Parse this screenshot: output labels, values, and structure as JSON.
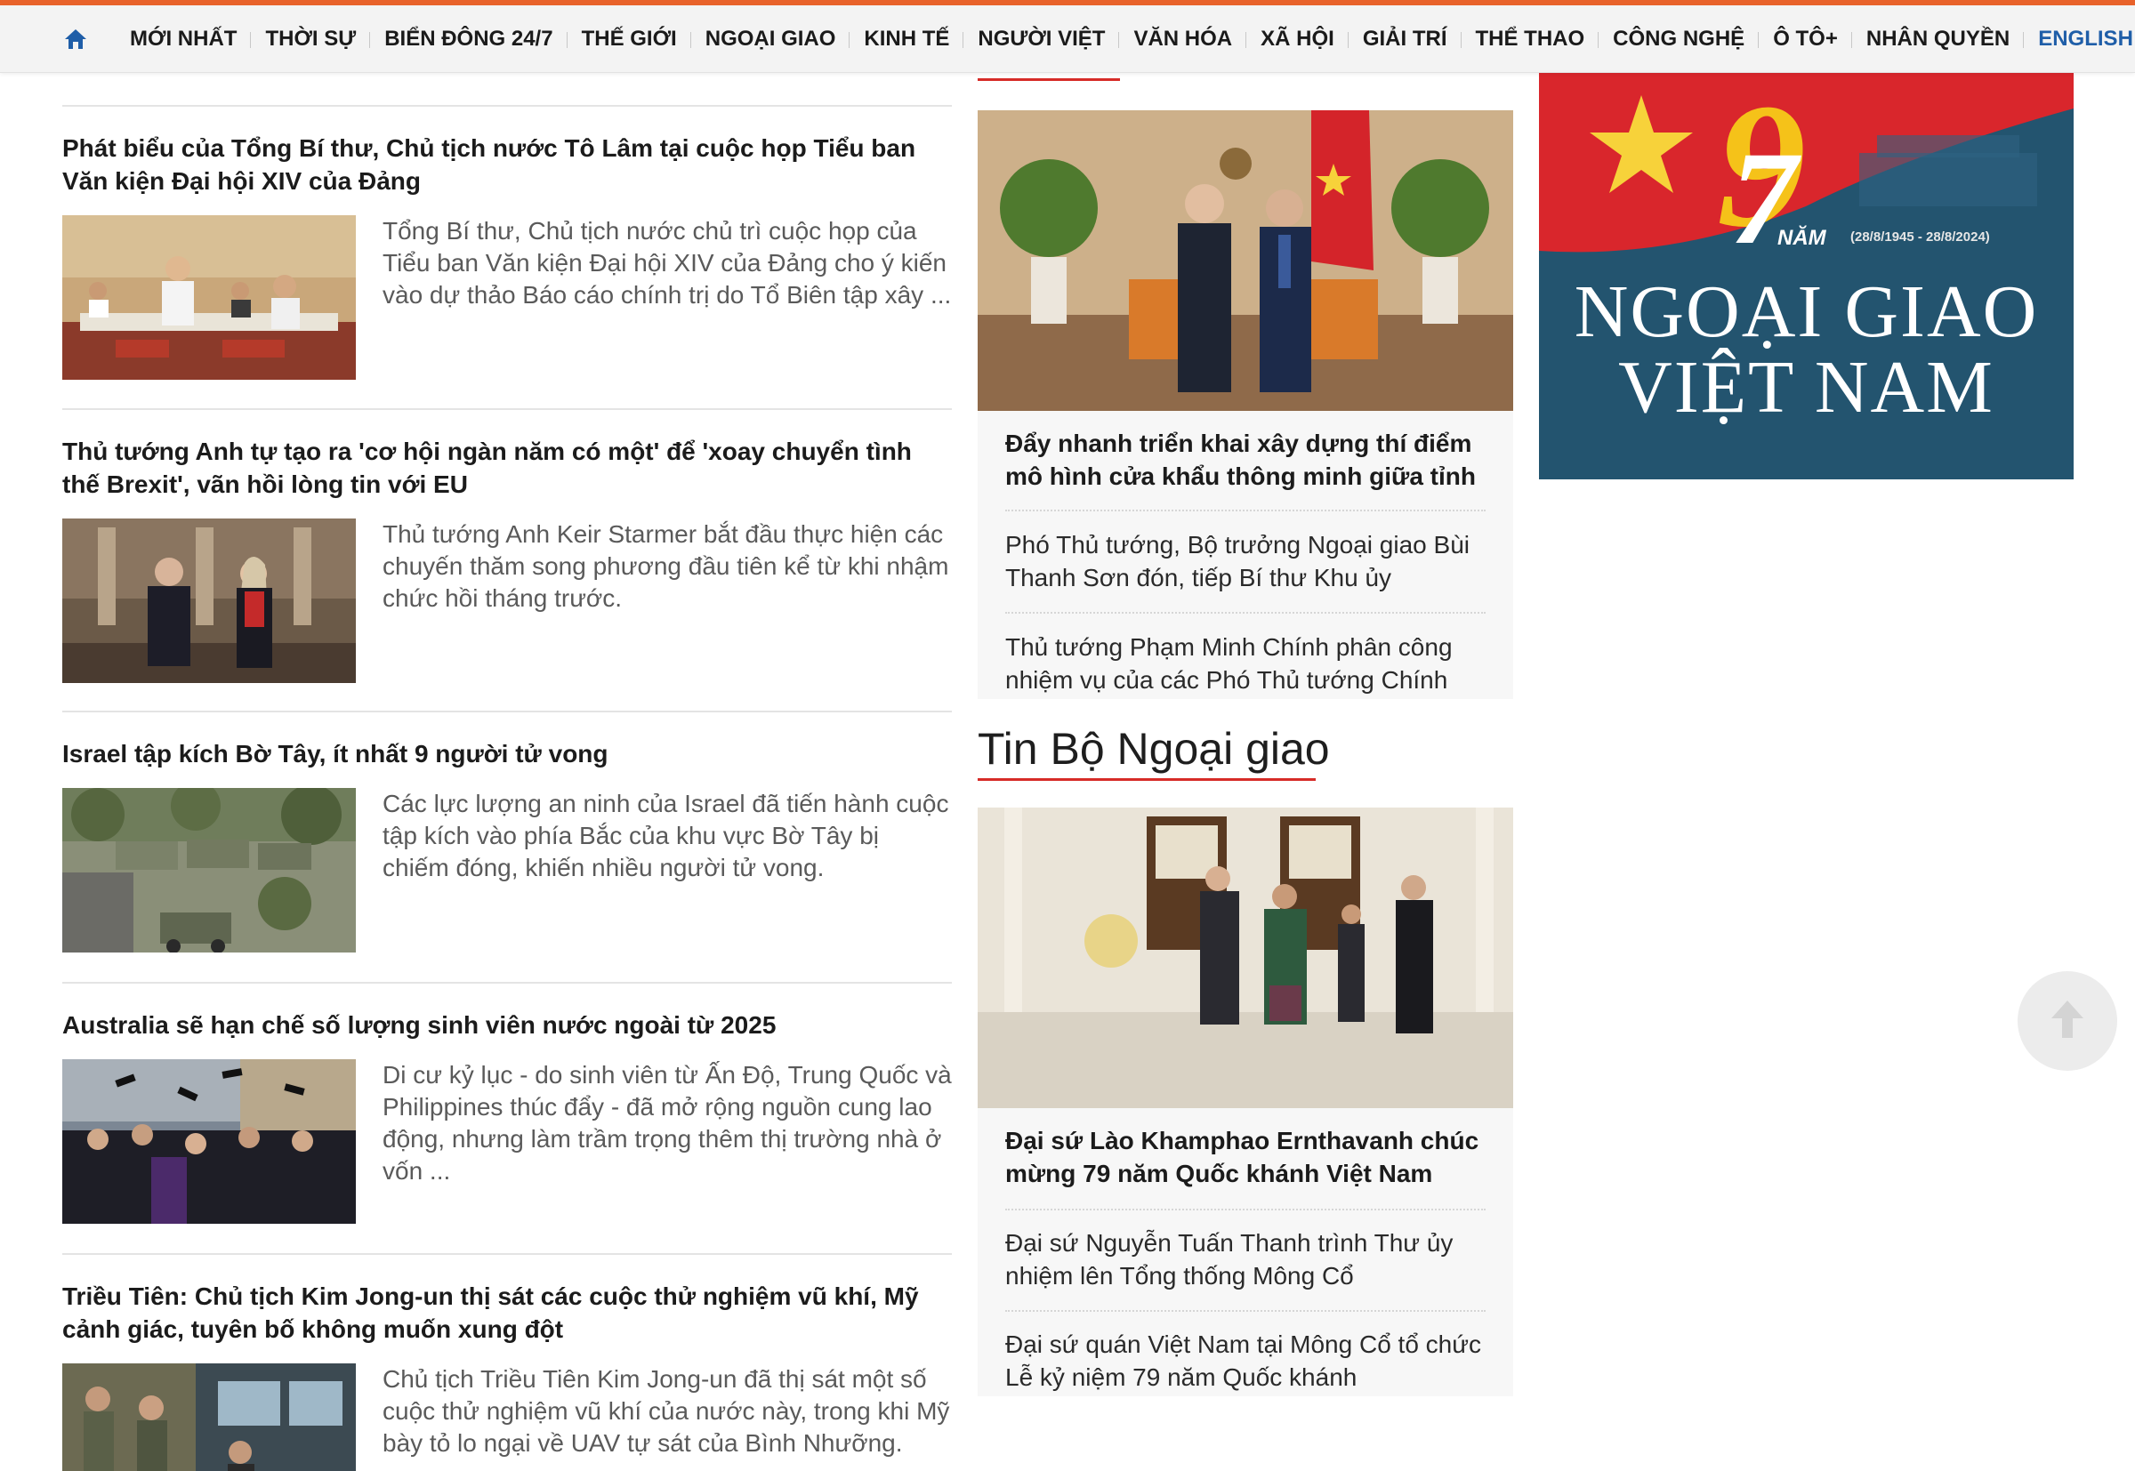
{
  "nav": {
    "home_icon": "home-icon",
    "items": [
      "MỚI NHẤT",
      "THỜI SỰ",
      "BIỂN ĐÔNG 24/7",
      "THẾ GIỚI",
      "NGOẠI GIAO",
      "KINH TẾ",
      "NGƯỜI VIỆT",
      "VĂN HÓA",
      "XÃ HỘI",
      "GIẢI TRÍ",
      "THỂ THAO",
      "CÔNG NGHỆ",
      "Ô TÔ+",
      "NHÂN QUYỀN"
    ],
    "english_label": "ENGLISH",
    "accent_color": "#e8622a",
    "english_color": "#1f5ea8"
  },
  "articles": [
    {
      "title": "Phát biểu của Tổng Bí thư, Chủ tịch nước Tô Lâm tại cuộc họp Tiểu ban Văn kiện Đại hội XIV của Đảng",
      "summary": "Tổng Bí thư, Chủ tịch nước chủ trì cuộc họp của Tiểu ban Văn kiện Đại hội XIV của Đảng cho ý kiến vào dự thảo Báo cáo chính trị do Tổ Biên tập xây ..."
    },
    {
      "title": "Thủ tướng Anh tự tạo ra 'cơ hội ngàn năm có một' để 'xoay chuyển tình thế Brexit', vãn hồi lòng tin với EU",
      "summary": "Thủ tướng Anh Keir Starmer bắt đầu thực hiện các chuyến thăm song phương đầu tiên kể từ khi nhậm chức hồi tháng trước."
    },
    {
      "title": "Israel tập kích Bờ Tây, ít nhất 9 người tử vong",
      "summary": "Các lực lượng an ninh của Israel đã tiến hành cuộc tập kích vào phía Bắc của khu vực Bờ Tây bị chiếm đóng, khiến nhiều người tử vong."
    },
    {
      "title": "Australia sẽ hạn chế số lượng sinh viên nước ngoài từ 2025",
      "summary": "Di cư kỷ lục - do sinh viên từ Ấn Độ, Trung Quốc và Philippines thúc đẩy - đã mở rộng nguồn cung lao động, nhưng làm trầm trọng thêm thị trường nhà ở vốn ..."
    },
    {
      "title": "Triều Tiên: Chủ tịch Kim Jong-un thị sát các cuộc thử nghiệm vũ khí, Mỹ cảnh giác, tuyên bố không muốn xung đột",
      "summary": "Chủ tịch Triều Tiên Kim Jong-un đã thị sát một số cuộc thử nghiệm vũ khí của nước này, trong khi Mỹ bày tỏ lo ngại về UAV tự sát của Bình Nhưỡng."
    }
  ],
  "middle": {
    "top_block": {
      "lead": "Đẩy nhanh triển khai xây dựng thí điểm mô hình cửa khẩu thông minh giữa tỉnh Lạng...",
      "items": [
        "Phó Thủ tướng, Bộ trưởng Ngoại giao Bùi Thanh Sơn đón, tiếp Bí thư Khu ủy Quảng...",
        "Thủ tướng Phạm Minh Chính phân công nhiệm vụ của các Phó Thủ tướng Chính p..."
      ]
    },
    "section_title": "Tin Bộ Ngoại giao",
    "section_block": {
      "lead": "Đại sứ Lào Khamphao Ernthavanh chúc mừng 79 năm Quốc khánh Việt Nam",
      "items": [
        "Đại sứ Nguyễn Tuấn Thanh trình Thư ủy nhiệm lên Tổng thống Mông Cổ Ukhnaagii...",
        "Đại sứ quán Việt Nam tại Mông Cổ tổ chức Lễ kỷ niệm 79 năm Quốc khánh"
      ]
    },
    "section_accent": "#d62b27"
  },
  "banner": {
    "number_nine": "9",
    "number_seven": "7",
    "nam_label": "NĂM",
    "dates": "(28/8/1945 - 28/8/2024)",
    "line1": "NGOẠI GIAO",
    "line2": "VIỆT NAM",
    "background": "#23546f"
  },
  "scroll_top_icon": "arrow-up-icon"
}
